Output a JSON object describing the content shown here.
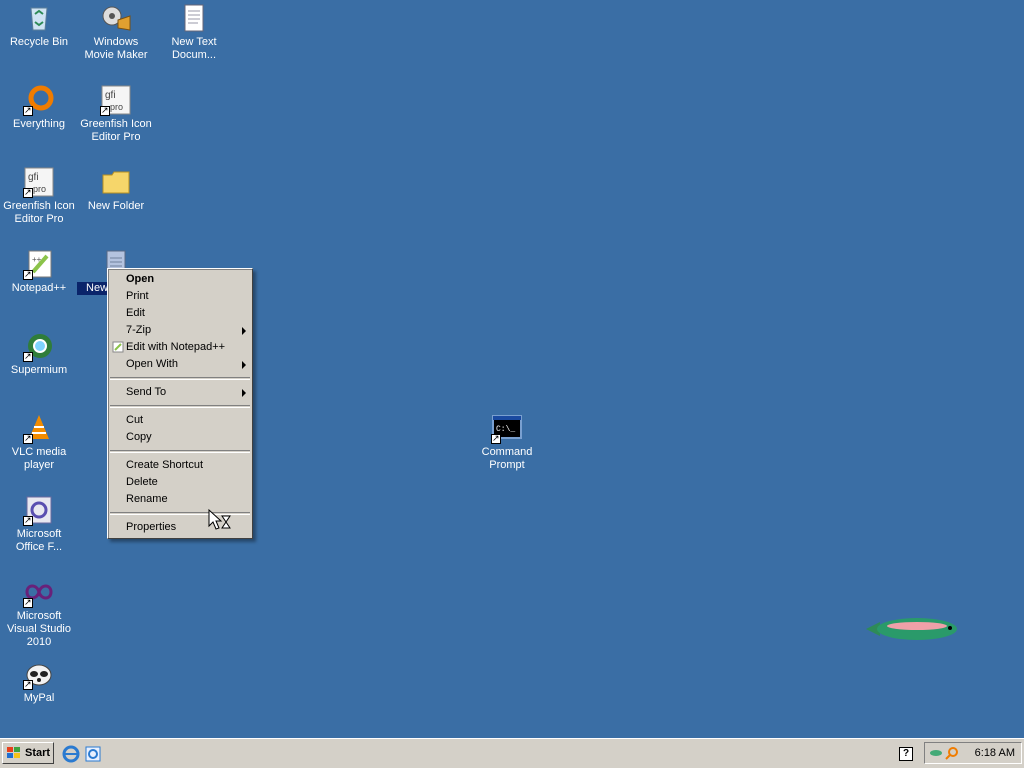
{
  "desktop": {
    "icons": [
      {
        "label": "Recycle Bin",
        "icon": "recycle-bin-icon"
      },
      {
        "label": "Windows Movie Maker",
        "icon": "movie-maker-icon"
      },
      {
        "label": "New Text Docum...",
        "icon": "text-document-icon"
      },
      {
        "label": "Everything",
        "icon": "everything-search-icon"
      },
      {
        "label": "Greenfish Icon Editor Pro",
        "icon": "greenfish-icon"
      },
      {
        "label": "Greenfish Icon Editor Pro",
        "icon": "greenfish-icon"
      },
      {
        "label": "New Folder",
        "icon": "folder-icon"
      },
      {
        "label": "Notepad++",
        "icon": "notepad-plus-plus-icon"
      },
      {
        "label": "New Docu...",
        "icon": "text-document-icon"
      },
      {
        "label": "Supermium",
        "icon": "supermium-browser-icon"
      },
      {
        "label": "VLC media player",
        "icon": "vlc-icon"
      },
      {
        "label": "Microsoft Office F...",
        "icon": "office-icon"
      },
      {
        "label": "Microsoft Visual Studio 2010",
        "icon": "visual-studio-icon"
      },
      {
        "label": "MyPal",
        "icon": "mypal-browser-icon"
      },
      {
        "label": "Command Prompt",
        "icon": "command-prompt-icon"
      }
    ]
  },
  "context_menu": {
    "items": [
      "Open",
      "Print",
      "Edit",
      "7-Zip",
      "Edit with Notepad++",
      "Open With",
      "Send To",
      "Cut",
      "Copy",
      "Create Shortcut",
      "Delete",
      "Rename",
      "Properties"
    ]
  },
  "taskbar": {
    "start_label": "Start",
    "clock": "6:18 AM"
  },
  "colors": {
    "desktop": "#3a6ea5",
    "selection": "#0a246a",
    "menu_face": "#d4d0c8"
  }
}
